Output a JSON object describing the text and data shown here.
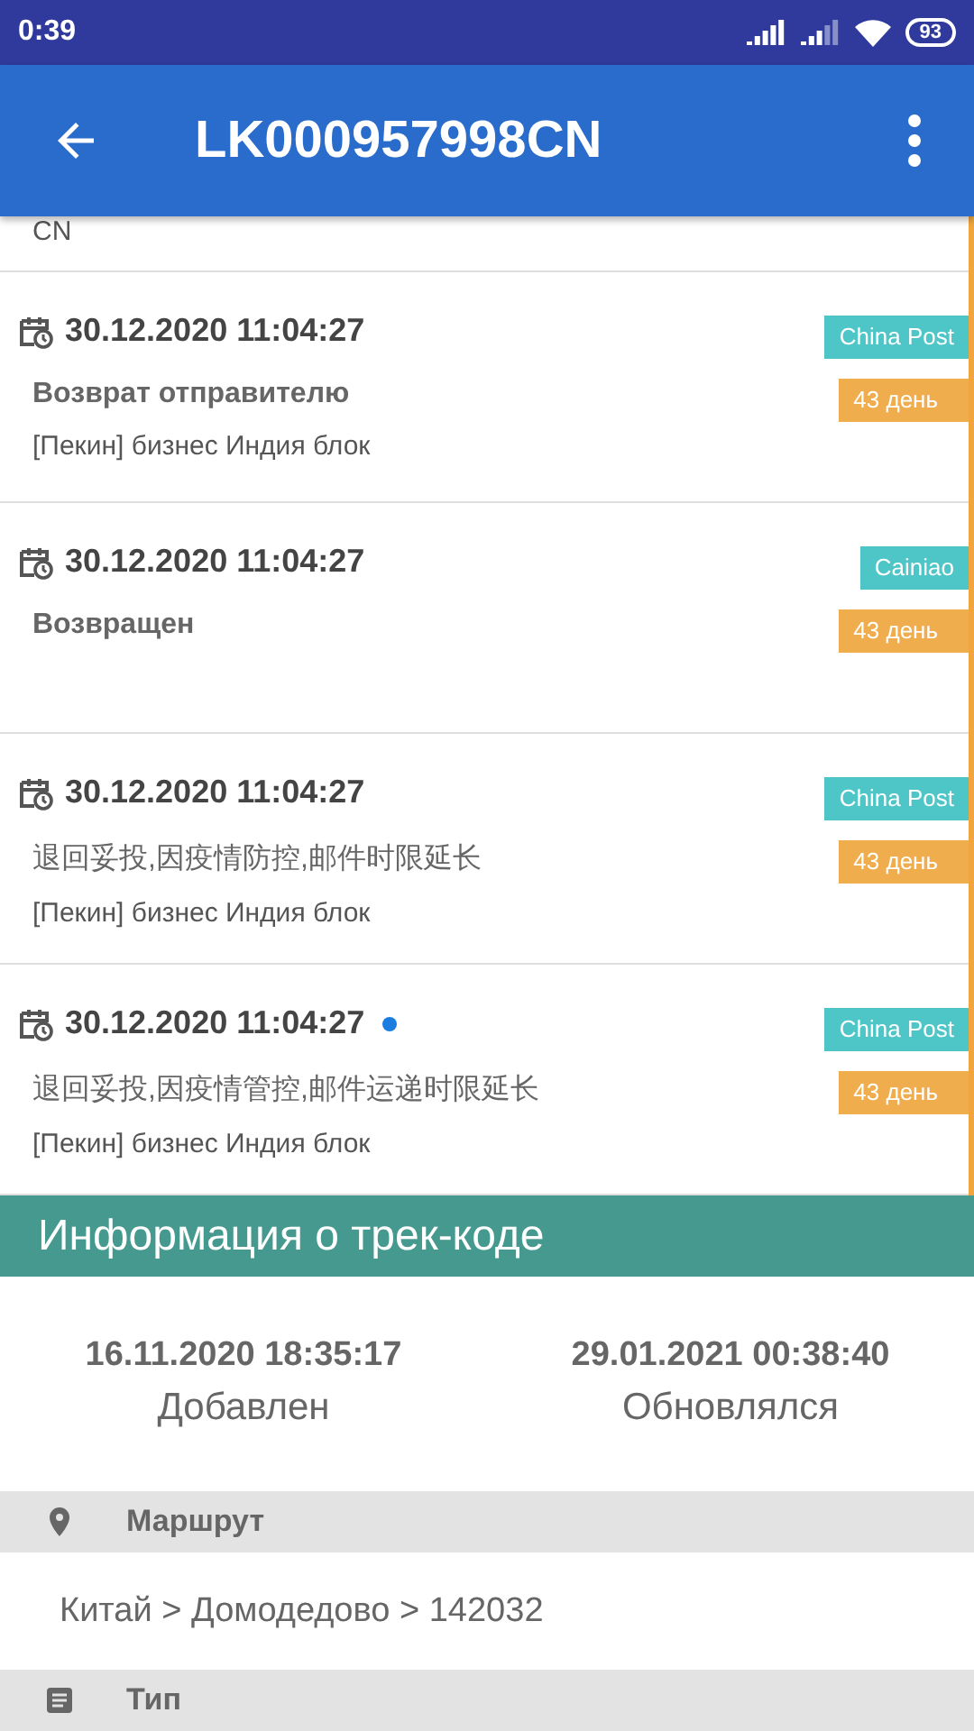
{
  "status_bar": {
    "time": "0:39",
    "battery": "93"
  },
  "app_bar": {
    "title": "LK000957998CN"
  },
  "partial_event": {
    "location": "CN"
  },
  "events": [
    {
      "date": "30.12.2020 11:04:27",
      "new": false,
      "carrier": "China Post",
      "days": "43 день",
      "status": "Возврат отправителю",
      "location": "[Пекин] бизнес Индия блок"
    },
    {
      "date": "30.12.2020 11:04:27",
      "new": false,
      "carrier": "Cainiao",
      "days": "43 день",
      "status": "Возвращен"
    },
    {
      "date": "30.12.2020 11:04:27",
      "new": false,
      "carrier": "China Post",
      "days": "43 день",
      "status": "退回妥投,因疫情防控,邮件时限延长",
      "location": "[Пекин] бизнес Индия блок"
    },
    {
      "date": "30.12.2020 11:04:27",
      "new": true,
      "carrier": "China Post",
      "days": "43 день",
      "status": "退回妥投,因疫情管控,邮件运递时限延长",
      "location": "[Пекин] бизнес Индия блок"
    }
  ],
  "info": {
    "title": "Информация о трек-коде",
    "stats": [
      {
        "value": "16.11.2020 18:35:17",
        "label": "Добавлен"
      },
      {
        "value": "29.01.2021 00:38:40",
        "label": "Обновлялся"
      }
    ],
    "sections": [
      {
        "kind": "route",
        "title": "Маршрут",
        "value": "Китай > Домодедово > 142032"
      },
      {
        "kind": "type",
        "title": "Тип"
      }
    ]
  }
}
